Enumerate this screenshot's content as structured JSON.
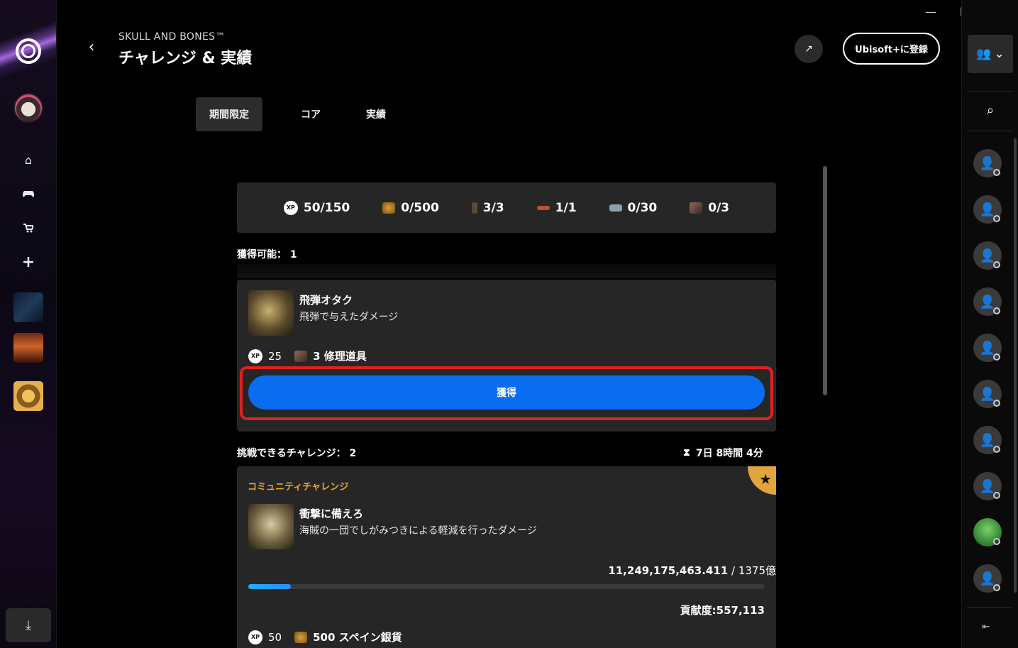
{
  "window": {
    "minimize": "—",
    "maximize": "☐",
    "close": "✕"
  },
  "header": {
    "game_name": "SKULL AND BONES™",
    "title": "チャレンジ & 実績",
    "ubisoft_plus_label": "Ubisoft+に登録"
  },
  "tabs": [
    {
      "label": "期間限定",
      "active": true
    },
    {
      "label": "コア",
      "active": false
    },
    {
      "label": "実績",
      "active": false
    }
  ],
  "rewards_summary": [
    {
      "icon": "xp-icon",
      "value": "50/150"
    },
    {
      "icon": "silver-coin-icon",
      "value": "0/500"
    },
    {
      "icon": "figurehead-icon",
      "value": "3/3"
    },
    {
      "icon": "banner-icon",
      "value": "1/1"
    },
    {
      "icon": "fish-icon",
      "value": "0/30"
    },
    {
      "icon": "repair-kit-icon",
      "value": "0/3"
    }
  ],
  "claimable": {
    "label": "獲得可能： 1",
    "card": {
      "title": "飛弾オタク",
      "description": "飛弾で与えたダメージ",
      "xp": "25",
      "reward": "3 修理道具",
      "claim_label": "獲得"
    }
  },
  "challenges": {
    "label": "挑戦できるチャレンジ： 2",
    "timer": "7日 8時間 4分",
    "card": {
      "tag": "コミュニティチャレンジ",
      "title": "衝撃に備えろ",
      "description": "海賊の一団でしがみつきによる軽減を行ったダメージ",
      "progress_current": "11,249,175,463.411",
      "progress_total": " / 1375億",
      "progress_fraction": 0.082,
      "contribution": "貢献度:557,113",
      "xp": "50",
      "reward": "500 スペイン銀貨"
    }
  },
  "colors": {
    "accent_blue": "#0a6df0",
    "highlight_red": "#e02020",
    "community_gold": "#e7a83a"
  }
}
